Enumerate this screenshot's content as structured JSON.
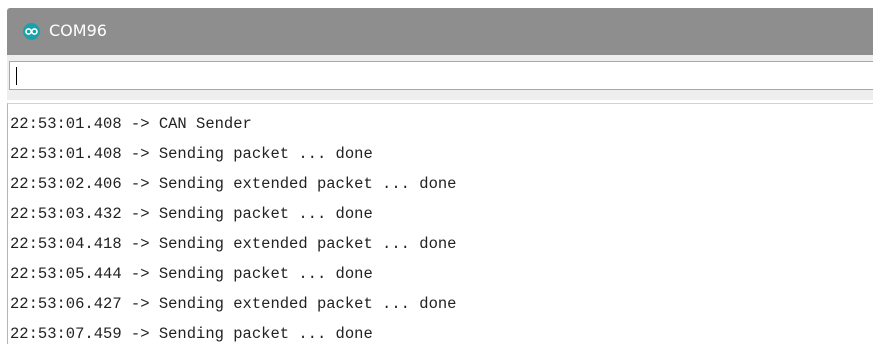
{
  "window": {
    "title": "COM96",
    "icon": "arduino-icon",
    "titlebar_color": "#8e8e8e",
    "icon_color": "#19a3a8"
  },
  "send_input": {
    "value": ""
  },
  "output": {
    "lines": [
      "22:53:01.408 -> CAN Sender",
      "22:53:01.408 -> Sending packet ... done",
      "22:53:02.406 -> Sending extended packet ... done",
      "22:53:03.432 -> Sending packet ... done",
      "22:53:04.418 -> Sending extended packet ... done",
      "22:53:05.444 -> Sending packet ... done",
      "22:53:06.427 -> Sending extended packet ... done",
      "22:53:07.459 -> Sending packet ... done"
    ]
  }
}
